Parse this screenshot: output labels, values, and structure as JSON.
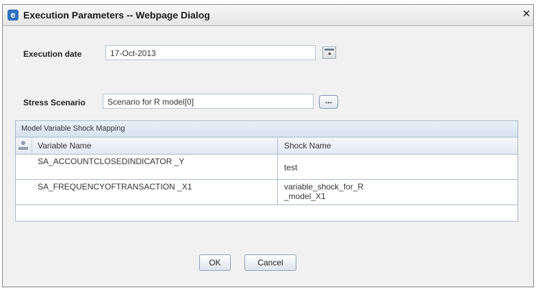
{
  "window": {
    "title": "Execution Parameters -- Webpage Dialog",
    "title_icon": "ie-icon",
    "close_glyph": "✕"
  },
  "form": {
    "execution_date_label": "Execution date",
    "execution_date_value": "17-Oct-2013",
    "stress_scenario_label": "Stress Scenario",
    "stress_scenario_value": "Scenario for R model[0]",
    "ellipsis_label": "..."
  },
  "grid": {
    "caption": "Model Variable Shock Mapping",
    "columns": [
      "Variable Name",
      "Shock Name"
    ],
    "rows": [
      {
        "variable": "SA_ACCOUNTCLOSEDINDICATOR _Y",
        "shock": "test"
      },
      {
        "variable": "SA_FREQUENCYOFTRANSACTION _X1",
        "shock": "variable_shock_for_R _model_X1"
      }
    ]
  },
  "buttons": {
    "ok": "OK",
    "cancel": "Cancel"
  },
  "colors": {
    "accent": "#2f6fc0",
    "grid_border": "#a9b9cc"
  }
}
